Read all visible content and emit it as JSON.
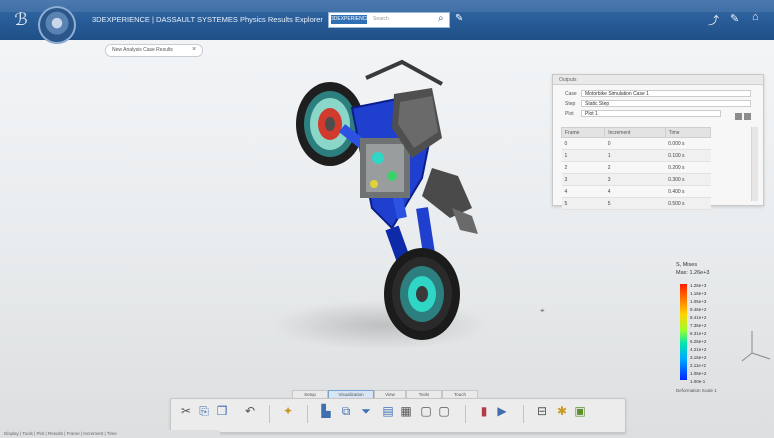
{
  "app": {
    "title": "3DEXPERIENCE | DASSAULT SYSTEMES Physics Results Explorer",
    "tab": "New Analysis Case Results"
  },
  "search": {
    "scope": "3DEXPERIENCE",
    "placeholder": "Search"
  },
  "panel": {
    "title": "Outputs",
    "fields": [
      {
        "key": "Case",
        "value": "Motorbike Simulation Case 1"
      },
      {
        "key": "Step",
        "value": "Static Step"
      },
      {
        "key": "Plot",
        "value": "Plot 1"
      }
    ],
    "columns": [
      "Frame",
      "Increment",
      "Time"
    ],
    "rows": [
      [
        "0",
        "0",
        "0.000 s"
      ],
      [
        "1",
        "1",
        "0.100 s"
      ],
      [
        "2",
        "2",
        "0.200 s"
      ],
      [
        "3",
        "3",
        "0.300 s"
      ],
      [
        "4",
        "4",
        "0.400 s"
      ],
      [
        "5",
        "5",
        "0.500 s"
      ]
    ]
  },
  "legend": {
    "title": "S, Mises",
    "subtitle": "Max: 1.26e+3",
    "ticks": [
      "1.26e+3",
      "1.16e+3",
      "1.05e+3",
      "9.46e+2",
      "8.41e+2",
      "7.36e+2",
      "6.31e+2",
      "5.26e+2",
      "4.21e+2",
      "3.16e+2",
      "2.11e+2",
      "1.06e+2",
      "1.00e-1"
    ],
    "note": "Deformation Scale 1"
  },
  "toolbar": {
    "tabs": [
      "Setup",
      "Visualization",
      "View",
      "Tools",
      "Touch"
    ]
  },
  "status": {
    "text": "Display | Tools | Plot | Results | Frame | Increment | Time"
  },
  "colors": {
    "titlebar": "#2a5e9a",
    "accent": "#2f6fb5"
  },
  "icons": [
    "compass-icon",
    "search-icon",
    "tag-icon",
    "share-icon",
    "home-icon",
    "close-icon"
  ]
}
